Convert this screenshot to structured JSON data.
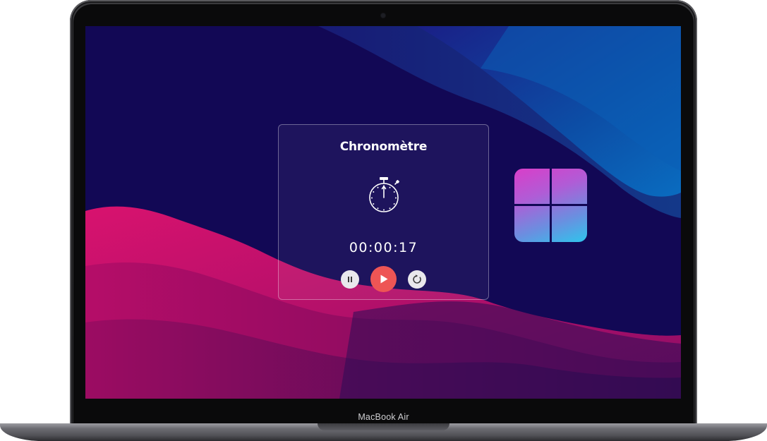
{
  "device": {
    "model_label": "MacBook Air"
  },
  "stopwatch": {
    "title": "Chronomètre",
    "time": "00:00:17",
    "icon": "stopwatch-icon",
    "controls": {
      "pause": {
        "icon": "pause-icon",
        "glyph": "❚❚"
      },
      "play": {
        "icon": "play-icon",
        "glyph": "▶"
      },
      "reset": {
        "icon": "reset-icon",
        "glyph": "↻"
      }
    }
  },
  "desktop": {
    "logo": "windows-logo-icon"
  },
  "colors": {
    "background": "#120855",
    "play_button": "#ee5555",
    "secondary_button": "#e9e8ec",
    "accent_magenta": "#c8106c",
    "accent_blue": "#0a66b8"
  }
}
